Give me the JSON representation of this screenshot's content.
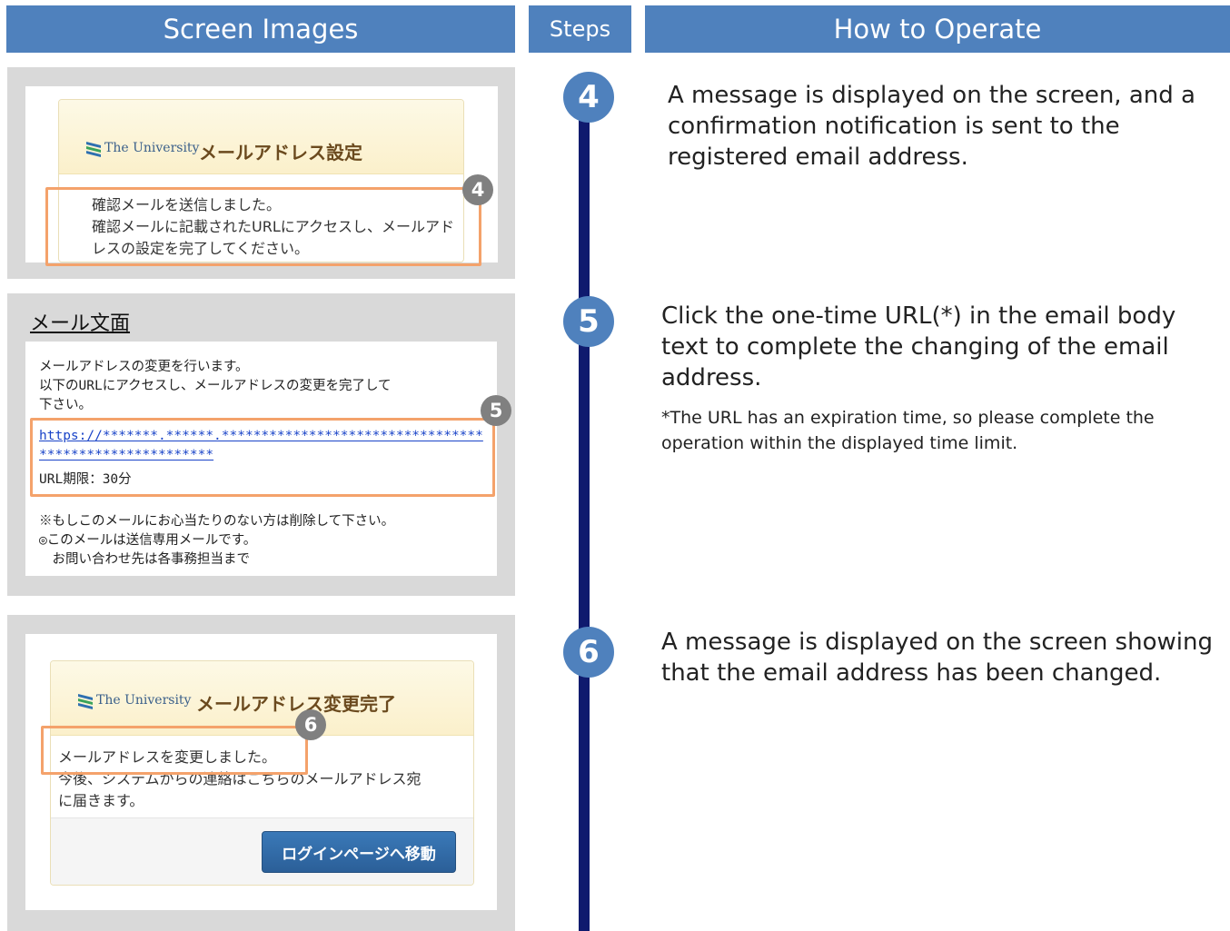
{
  "headers": {
    "screen_images": "Screen Images",
    "steps": "Steps",
    "how_to_operate": "How to Operate"
  },
  "logo_text": "The University",
  "step4": {
    "number": "4",
    "screen_title": "メールアドレス設定",
    "screen_lines": [
      "確認メールを送信しました。",
      "確認メールに記載されたURLにアクセスし、メールアド",
      "レスの設定を完了してください。"
    ],
    "badge": "4",
    "instruction": "A message is displayed on the screen, and a confirmation notification is sent to the registered email address."
  },
  "step5": {
    "number": "5",
    "mail_title": "メール文面",
    "mail_lines": [
      "メールアドレスの変更を行います。",
      "以下のURLにアクセスし、メールアドレスの変更を完了して",
      "下さい。"
    ],
    "url_line1": "https://*******.******.*********************************",
    "url_line2": "**********************",
    "url_limit": "URL期限：30分",
    "footer_lines": [
      "※もしこのメールにお心当たりのない方は削除して下さい。",
      "◎このメールは送信専用メールです。",
      "　お問い合わせ先は各事務担当まで"
    ],
    "badge": "5",
    "instruction": "Click the one-time URL(*) in the email body text to complete the changing of the email address.",
    "note": "*The URL has an expiration time, so please complete the operation within the displayed time limit."
  },
  "step6": {
    "number": "6",
    "screen_title": "メールアドレス変更完了",
    "screen_line1": "メールアドレスを変更しました。",
    "screen_line2": "今後、システムからの連絡はこちらのメールアドレス宛",
    "screen_line3": "に届きます。",
    "login_button": "ログインページへ移動",
    "badge": "6",
    "instruction": "A message is displayed on the screen showing that the email address has been changed."
  },
  "colors": {
    "header_bg": "#4f81bd",
    "step_circle": "#4f81bd",
    "timeline": "#0f1a6e",
    "highlight": "#f4a26b",
    "badge": "#808080"
  }
}
